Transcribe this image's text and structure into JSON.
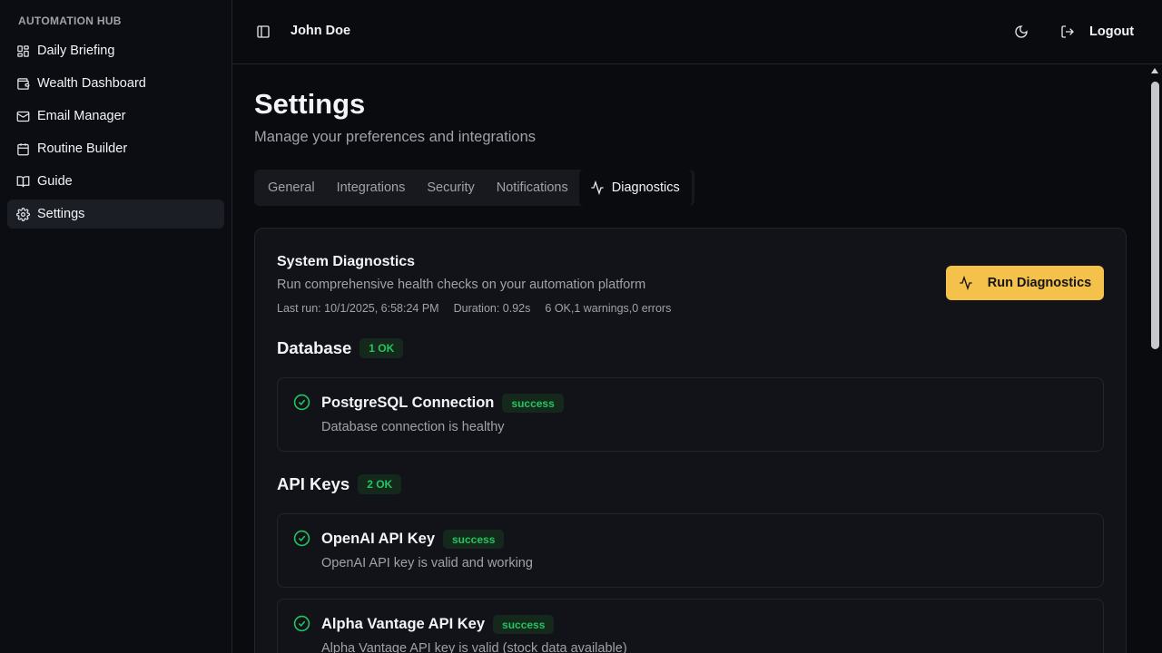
{
  "sidebar": {
    "brand": "AUTOMATION HUB",
    "items": [
      {
        "label": "Daily Briefing",
        "icon": "dashboard-grid-icon"
      },
      {
        "label": "Wealth Dashboard",
        "icon": "wallet-icon"
      },
      {
        "label": "Email Manager",
        "icon": "mail-icon"
      },
      {
        "label": "Routine Builder",
        "icon": "calendar-icon"
      },
      {
        "label": "Guide",
        "icon": "book-icon"
      },
      {
        "label": "Settings",
        "icon": "gear-icon",
        "active": true
      }
    ]
  },
  "topbar": {
    "user_name": "John Doe",
    "logout_label": "Logout"
  },
  "page": {
    "title": "Settings",
    "subtitle": "Manage your preferences and integrations"
  },
  "tabs": [
    {
      "label": "General"
    },
    {
      "label": "Integrations"
    },
    {
      "label": "Security"
    },
    {
      "label": "Notifications"
    },
    {
      "label": "Diagnostics",
      "active": true,
      "icon": "activity-icon"
    }
  ],
  "diagnostics": {
    "title": "System Diagnostics",
    "description": "Run comprehensive health checks on your automation platform",
    "last_run": "Last run: 10/1/2025, 6:58:24 PM",
    "duration": "Duration: 0.92s",
    "summary": "6 OK,1 warnings,0 errors",
    "run_button": "Run Diagnostics",
    "sections": [
      {
        "label": "Database",
        "count": "1 OK",
        "checks": [
          {
            "name": "PostgreSQL Connection",
            "status": "success",
            "message": "Database connection is healthy"
          }
        ]
      },
      {
        "label": "API Keys",
        "count": "2 OK",
        "checks": [
          {
            "name": "OpenAI API Key",
            "status": "success",
            "message": "OpenAI API key is valid and working"
          },
          {
            "name": "Alpha Vantage API Key",
            "status": "success",
            "message": "Alpha Vantage API key is valid (stock data available)"
          }
        ]
      }
    ]
  },
  "colors": {
    "accent": "#f4c14a",
    "success": "#22c55e",
    "background": "#0a0b0f",
    "card": "#111319"
  }
}
